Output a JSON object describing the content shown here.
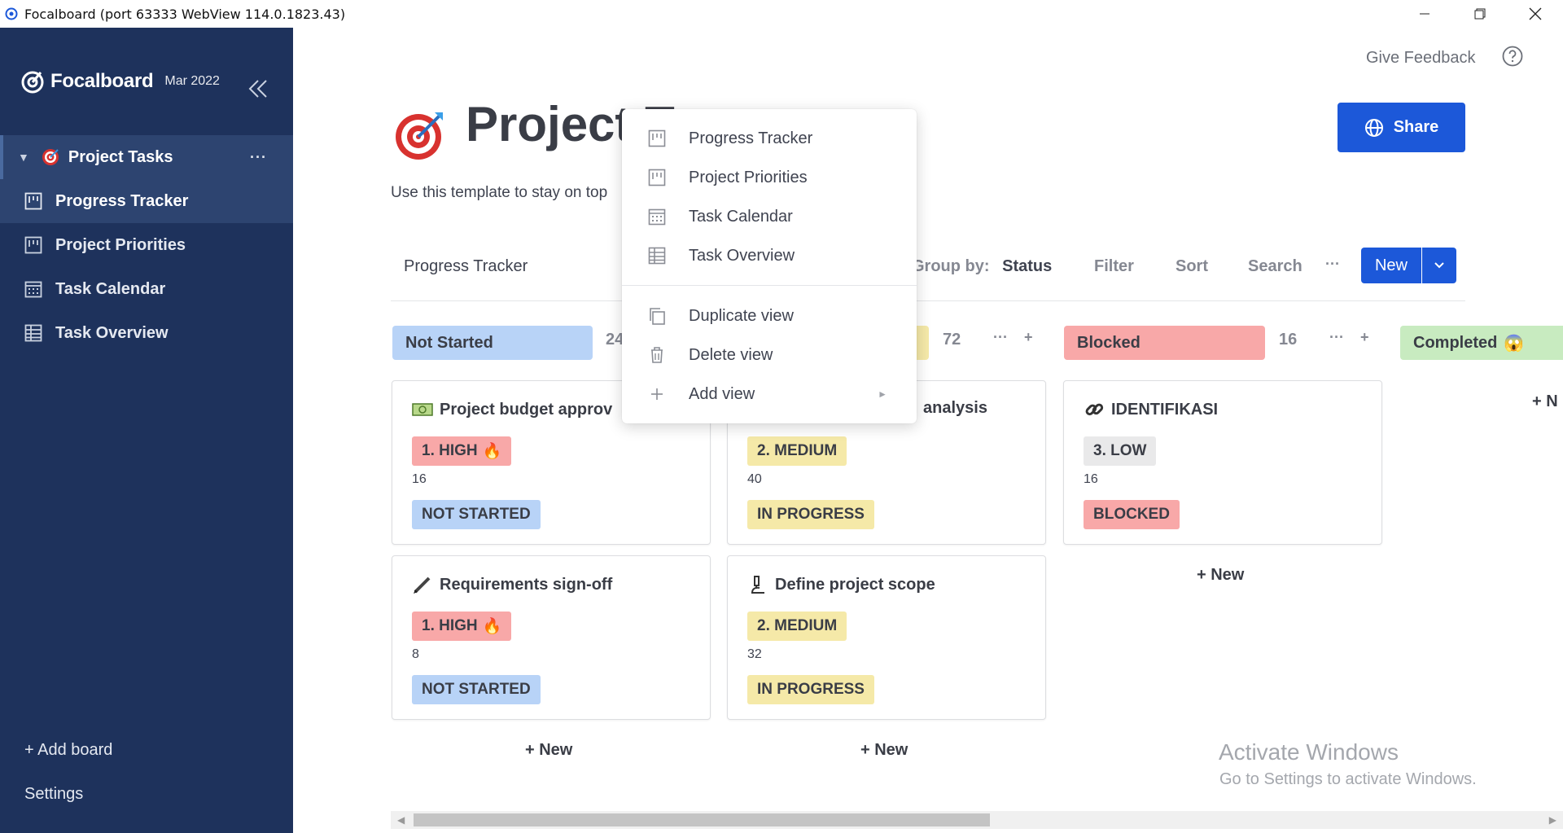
{
  "window": {
    "title": "Focalboard (port 63333 WebView 114.0.1823.43)"
  },
  "sidebar": {
    "brand": "Focalboard",
    "version": "Mar 2022",
    "board": {
      "label": "Project Tasks",
      "more": "···"
    },
    "views": [
      {
        "label": "Progress Tracker",
        "icon": "board-view-icon",
        "active": true
      },
      {
        "label": "Project Priorities",
        "icon": "board-view-icon",
        "active": false
      },
      {
        "label": "Task Calendar",
        "icon": "calendar-view-icon",
        "active": false
      },
      {
        "label": "Task Overview",
        "icon": "table-view-icon",
        "active": false
      }
    ],
    "add_board": "+ Add board",
    "settings": "Settings"
  },
  "header": {
    "feedback": "Give Feedback",
    "title": "Project T",
    "description": "Use this template to stay on top",
    "share": "Share"
  },
  "viewbar": {
    "view_name": "Progress Tracker",
    "group_by_label": "Group by:",
    "group_by_value": "Status",
    "filter": "Filter",
    "sort": "Sort",
    "search": "Search",
    "more": "···",
    "new": "New"
  },
  "columns": [
    {
      "name": "Not Started",
      "count": "24",
      "color": "#b8d3f7"
    },
    {
      "name": "",
      "count": "72",
      "color": "#f5e9a8"
    },
    {
      "name": "Blocked",
      "count": "16",
      "color": "#f8a8a8"
    },
    {
      "name": "Completed",
      "count": "",
      "color": "#c8ebc0"
    }
  ],
  "cards": [
    {
      "title": "Project budget approv",
      "priority": "1. HIGH",
      "priority_emoji": "🔥",
      "number": "16",
      "status": "NOT STARTED"
    },
    {
      "title": "analysis",
      "priority": "2. MEDIUM",
      "number": "40",
      "status": "IN PROGRESS"
    },
    {
      "title": "IDENTIFIKASI",
      "priority": "3. LOW",
      "number": "16",
      "status": "BLOCKED"
    },
    {
      "title": "Requirements sign-off",
      "priority": "1. HIGH",
      "priority_emoji": "🔥",
      "number": "8",
      "status": "NOT STARTED"
    },
    {
      "title": "Define project scope",
      "priority": "2. MEDIUM",
      "number": "32",
      "status": "IN PROGRESS"
    }
  ],
  "col_new": "+ New",
  "col_new_partial": "+ N",
  "completed_emoji": "😱",
  "menu": {
    "items": [
      {
        "label": "Progress Tracker",
        "icon": "board-view-icon"
      },
      {
        "label": "Project Priorities",
        "icon": "board-view-icon"
      },
      {
        "label": "Task Calendar",
        "icon": "calendar-view-icon"
      },
      {
        "label": "Task Overview",
        "icon": "table-view-icon"
      },
      {
        "label": "Duplicate view",
        "icon": "duplicate-icon"
      },
      {
        "label": "Delete view",
        "icon": "trash-icon"
      },
      {
        "label": "Add view",
        "icon": "plus-icon",
        "submenu_arrow": "►"
      }
    ]
  },
  "watermark": {
    "title": "Activate Windows",
    "subtitle": "Go to Settings to activate Windows."
  },
  "scroll": {
    "left": "◀",
    "right": "▶"
  }
}
